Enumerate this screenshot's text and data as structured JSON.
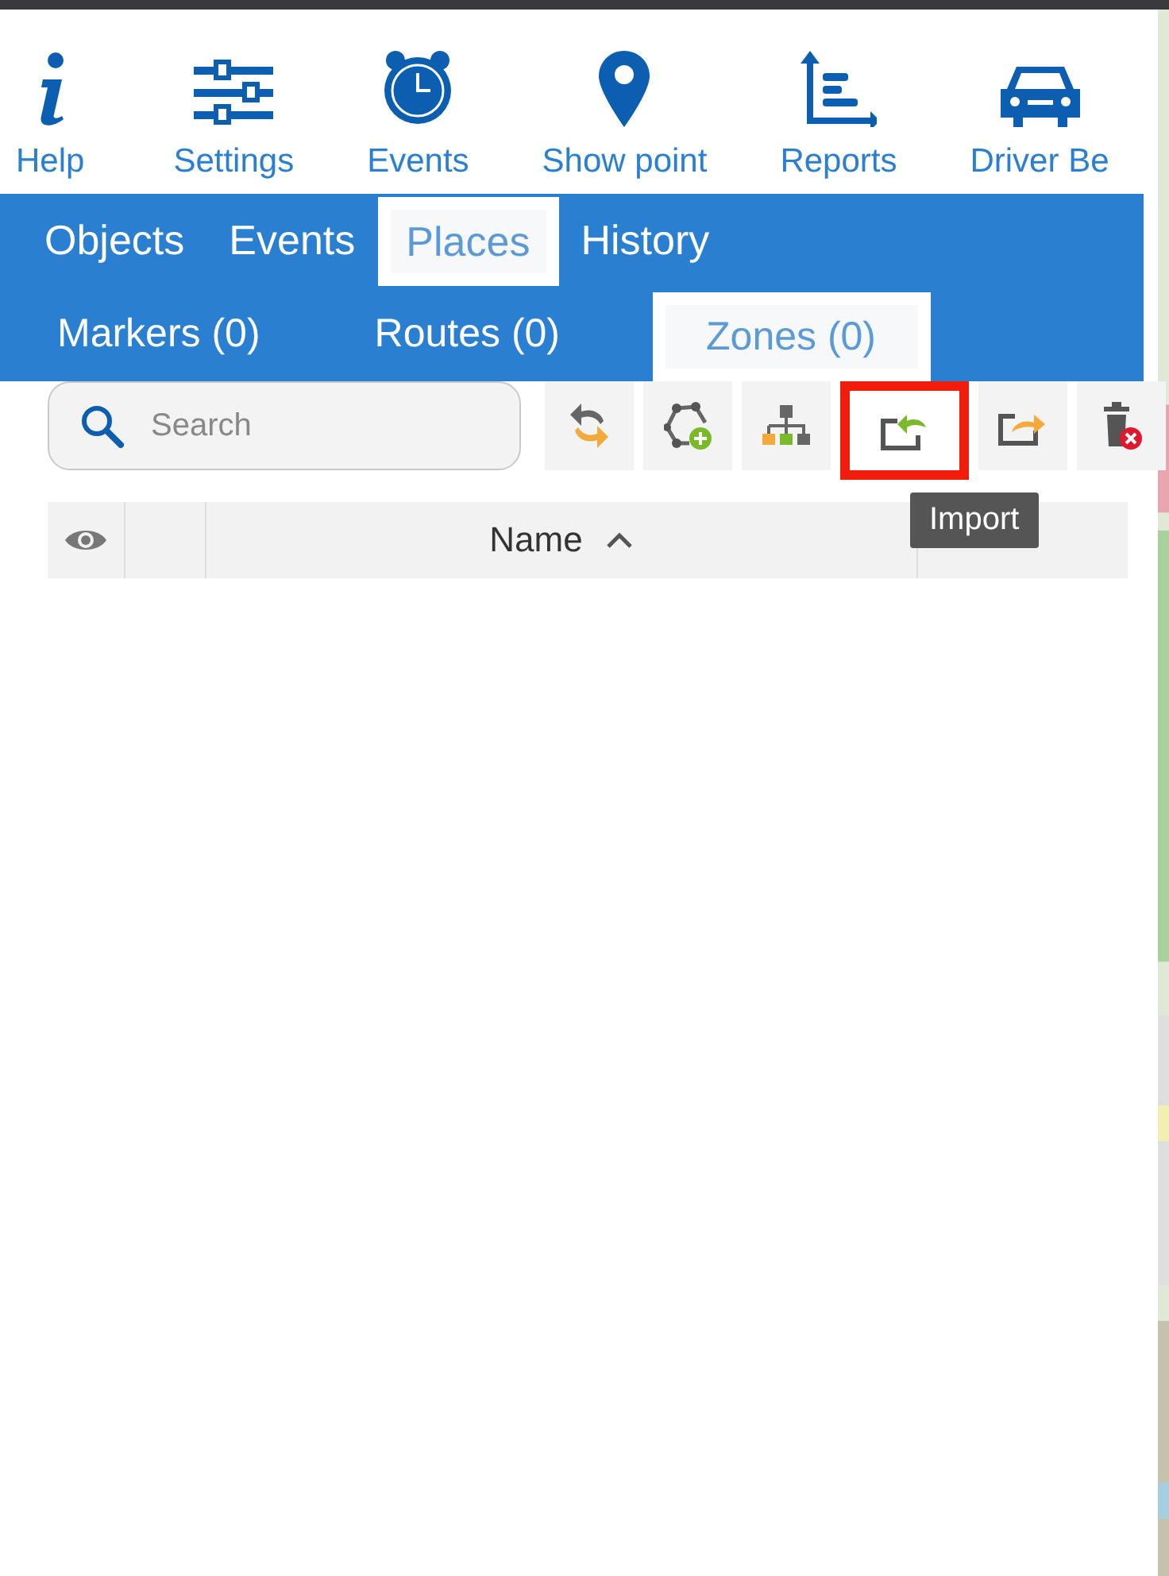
{
  "toolbar": [
    {
      "kind": "info",
      "label": "Help"
    },
    {
      "kind": "sliders",
      "label": "Settings"
    },
    {
      "kind": "clock",
      "label": "Events"
    },
    {
      "kind": "pin",
      "label": "Show point"
    },
    {
      "kind": "chart",
      "label": "Reports"
    },
    {
      "kind": "car",
      "label": "Driver Be"
    }
  ],
  "tabs": [
    {
      "label": "Objects",
      "selected": false
    },
    {
      "label": "Events",
      "selected": false
    },
    {
      "label": "Places",
      "selected": true
    },
    {
      "label": "History",
      "selected": false
    }
  ],
  "subtabs": [
    {
      "label": "Markers (0)",
      "selected": false
    },
    {
      "label": "Routes (0)",
      "selected": false
    },
    {
      "label": "Zones (0)",
      "selected": true
    }
  ],
  "search": {
    "placeholder": "Search"
  },
  "tools": [
    {
      "kind": "sync",
      "highlighted": false
    },
    {
      "kind": "add-zone",
      "highlighted": false
    },
    {
      "kind": "groups",
      "highlighted": false
    },
    {
      "kind": "import",
      "highlighted": true
    },
    {
      "kind": "export",
      "highlighted": false
    },
    {
      "kind": "delete",
      "highlighted": false
    }
  ],
  "tooltip": "Import",
  "table": {
    "columns": [
      {
        "kind": "eye"
      },
      {
        "kind": "blank"
      },
      {
        "kind": "text",
        "label": "Name",
        "sorted_ascending": true
      }
    ]
  }
}
